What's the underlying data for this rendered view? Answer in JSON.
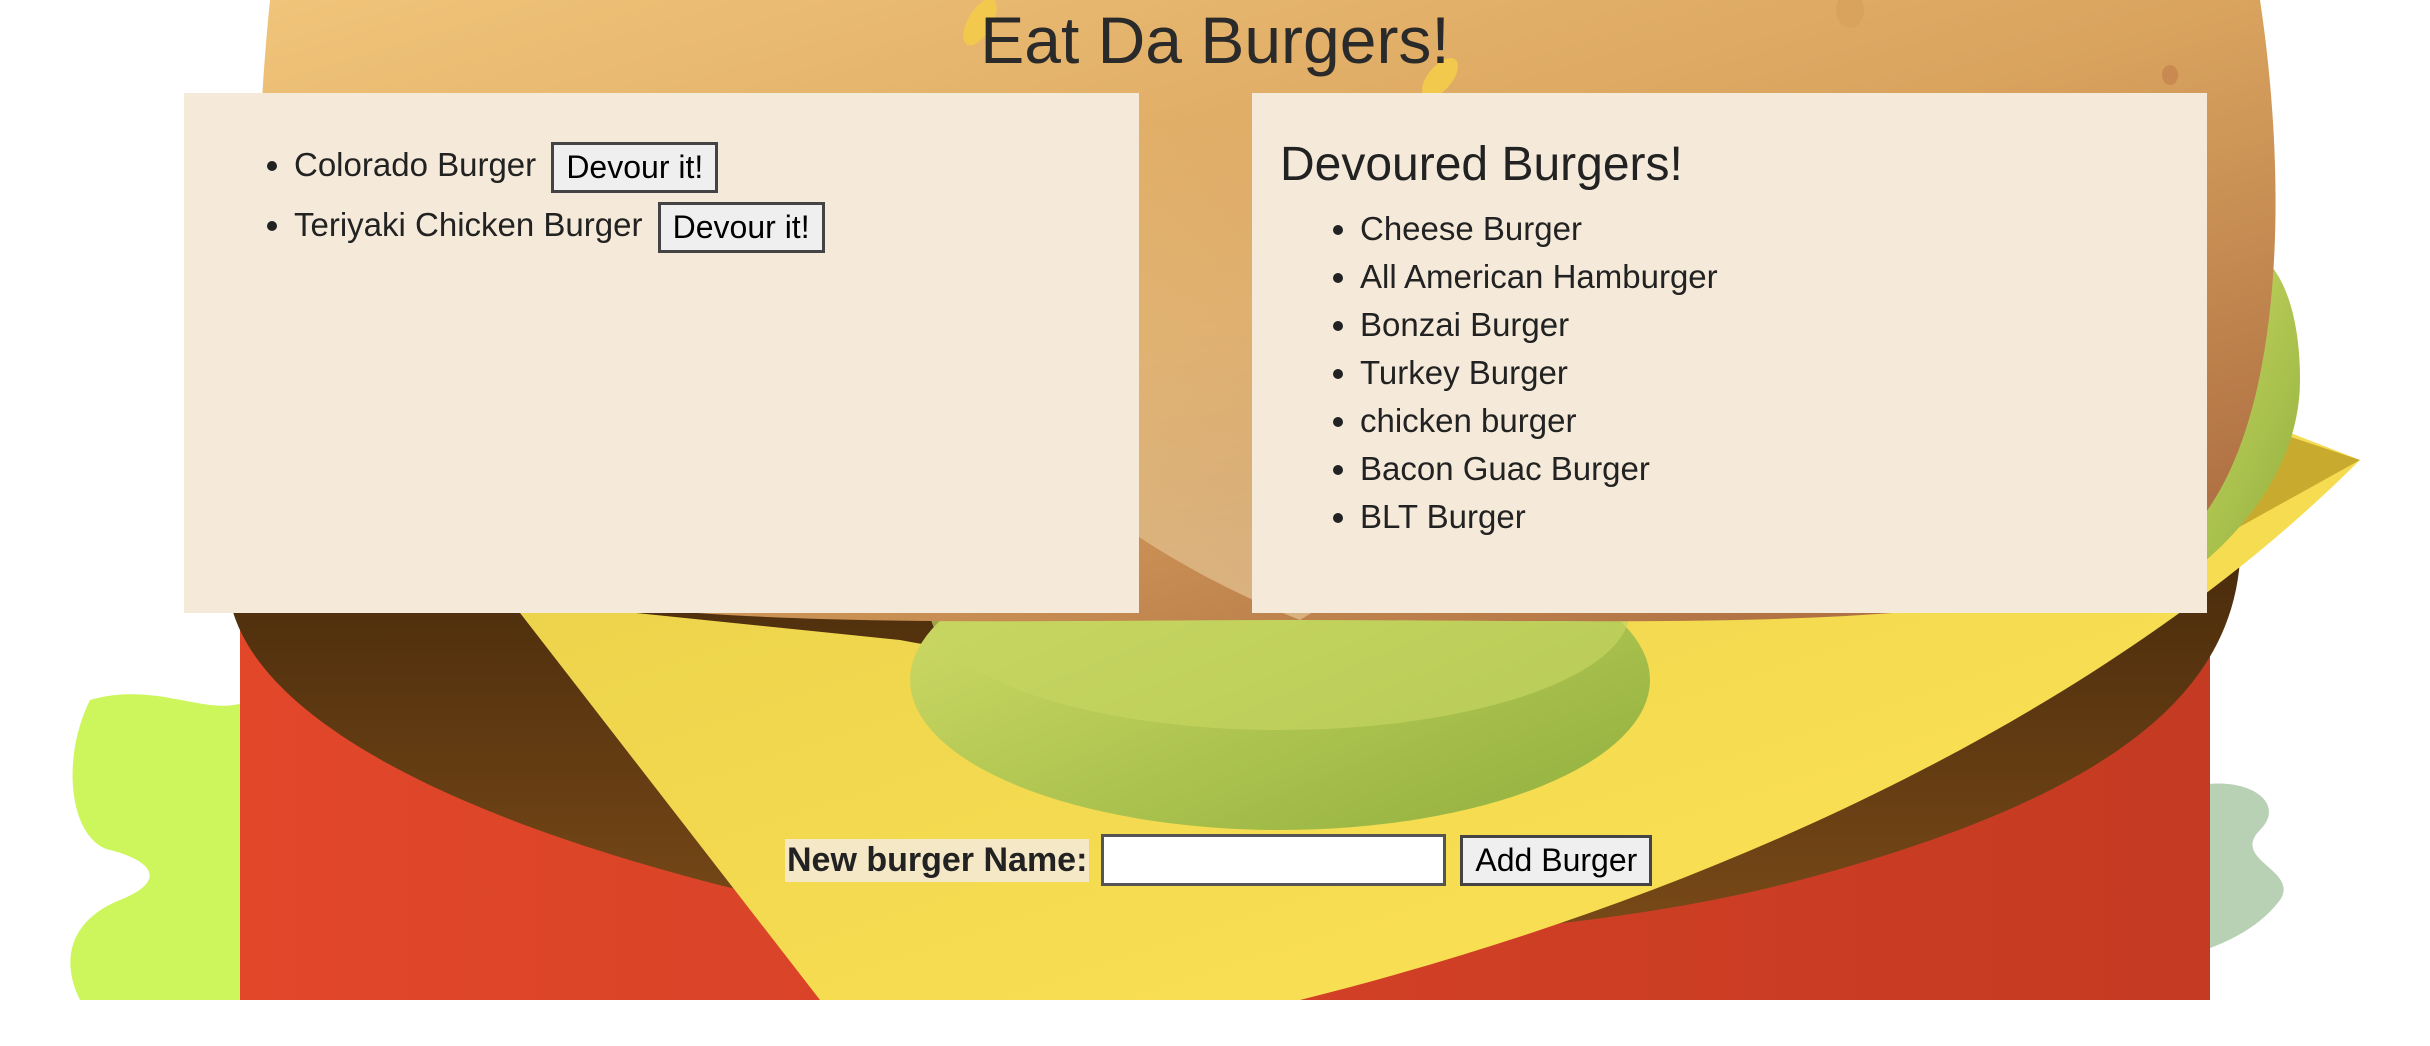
{
  "page": {
    "title": "Eat Da Burgers!"
  },
  "undevoured": [
    {
      "name": "Colorado Burger",
      "button": "Devour it!"
    },
    {
      "name": "Teriyaki Chicken Burger",
      "button": "Devour it!"
    }
  ],
  "devoured": {
    "heading": "Devoured Burgers!",
    "items": [
      "Cheese Burger",
      "All American Hamburger",
      "Bonzai Burger",
      "Turkey Burger",
      "chicken burger",
      "Bacon Guac Burger",
      "BLT Burger"
    ]
  },
  "form": {
    "label": "New burger Name:",
    "input_value": "",
    "submit": "Add Burger"
  },
  "colors": {
    "panel": "#f5eada",
    "text": "#222222"
  }
}
